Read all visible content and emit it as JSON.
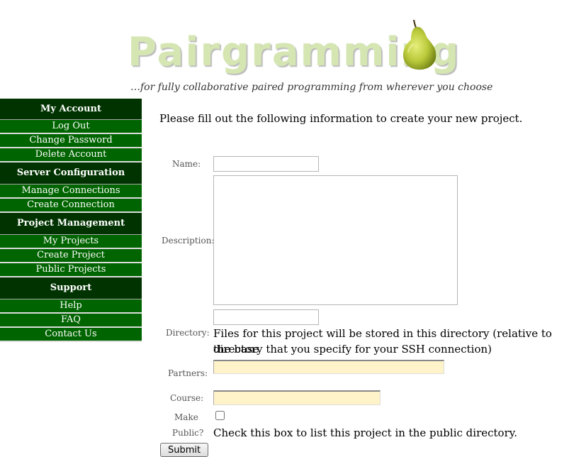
{
  "header": {
    "logo_text": "Pairgramming",
    "tagline": "…for fully collaborative paired programming from wherever you choose"
  },
  "sidebar": {
    "sections": [
      {
        "title": "My Account",
        "items": [
          "Log Out",
          "Change Password",
          "Delete Account"
        ]
      },
      {
        "title": "Server Configuration",
        "items": [
          "Manage Connections",
          "Create Connection"
        ]
      },
      {
        "title": "Project Management",
        "items": [
          "My Projects",
          "Create Project",
          "Public Projects"
        ]
      },
      {
        "title": "Support",
        "items": [
          "Help",
          "FAQ",
          "Contact Us"
        ]
      }
    ]
  },
  "form": {
    "intro": "Please fill out the following information to create your new project.",
    "name_label": "Name:",
    "name_value": "",
    "description_label": "Description:",
    "description_value": "",
    "directory_label": "Directory:",
    "directory_value": "",
    "directory_help_line1": "Files for this project will be stored in this directory (relative to the base",
    "directory_help_line2": "directory that you specify for your SSH connection)",
    "partners_label": "Partners:",
    "partners_value": "",
    "course_label": "Course:",
    "course_value": "",
    "public_label_line1": "Make",
    "public_label_line2": "Public?",
    "public_checked": false,
    "public_help": "Check this box to list this project in the public directory.",
    "submit_label": "Submit"
  },
  "colors": {
    "sidebar_header_bg": "#003300",
    "sidebar_link_bg": "#006400",
    "logo_color": "#d5e6b3",
    "autofill_yellow": "#fff3c9"
  }
}
